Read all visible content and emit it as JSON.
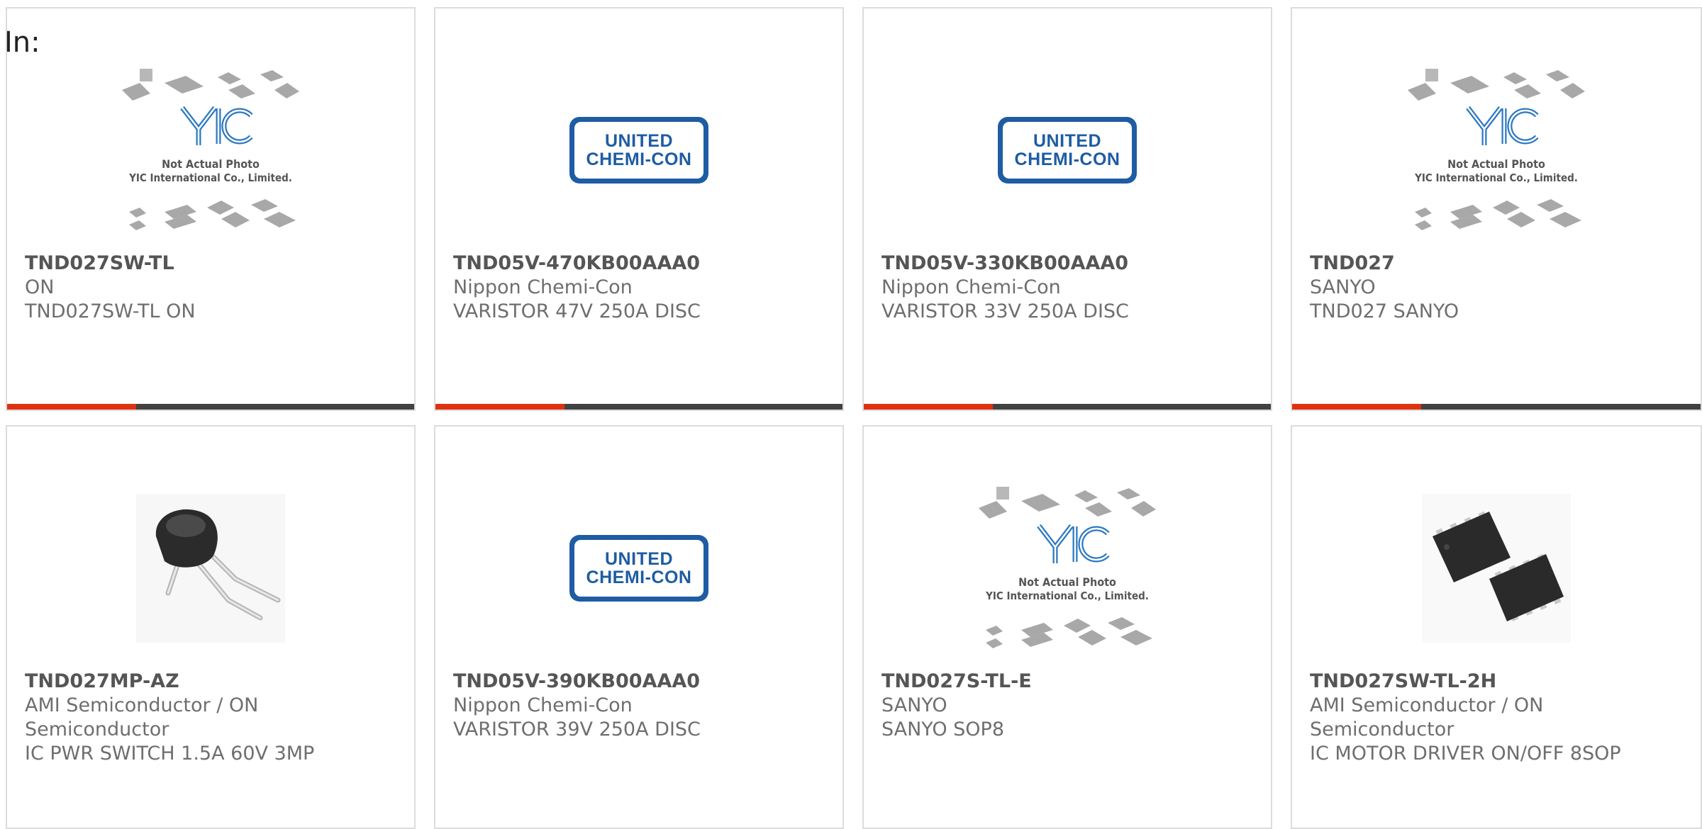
{
  "page": {
    "prefix_label": "In:"
  },
  "colors": {
    "accent": "#e0310f",
    "bar_dark": "#424242",
    "ucc_blue": "#1e5ca3",
    "yic_blue": "#2b78c2"
  },
  "placeholder": {
    "line1": "Not Actual Photo",
    "line2": "YIC International Co., Limited.",
    "logo": "YIC"
  },
  "ucc_logo": {
    "line1": "UNITED",
    "line2": "CHEMI-CON"
  },
  "products": [
    {
      "part": "TND027SW-TL",
      "manufacturer": "ON",
      "description": "TND027SW-TL ON",
      "image": "yic-placeholder"
    },
    {
      "part": "TND05V-470KB00AAA0",
      "manufacturer": "Nippon Chemi-Con",
      "description": "VARISTOR 47V 250A DISC",
      "image": "united-chemi-con-logo"
    },
    {
      "part": "TND05V-330KB00AAA0",
      "manufacturer": "Nippon Chemi-Con",
      "description": "VARISTOR 33V 250A DISC",
      "image": "united-chemi-con-logo"
    },
    {
      "part": "TND027",
      "manufacturer": "SANYO",
      "description": "TND027 SANYO",
      "image": "yic-placeholder"
    },
    {
      "part": "TND027MP-AZ",
      "manufacturer": "AMI Semiconductor / ON Semiconductor",
      "description": "IC PWR SWITCH 1.5A 60V 3MP",
      "image": "to92-transistor"
    },
    {
      "part": "TND05V-390KB00AAA0",
      "manufacturer": "Nippon Chemi-Con",
      "description": "VARISTOR 39V 250A DISC",
      "image": "united-chemi-con-logo"
    },
    {
      "part": "TND027S-TL-E",
      "manufacturer": "SANYO",
      "description": "SANYO SOP8",
      "image": "yic-placeholder"
    },
    {
      "part": "TND027SW-TL-2H",
      "manufacturer": "AMI Semiconductor / ON Semiconductor",
      "description": "IC MOTOR DRIVER ON/OFF 8SOP",
      "image": "sop8-package"
    }
  ]
}
